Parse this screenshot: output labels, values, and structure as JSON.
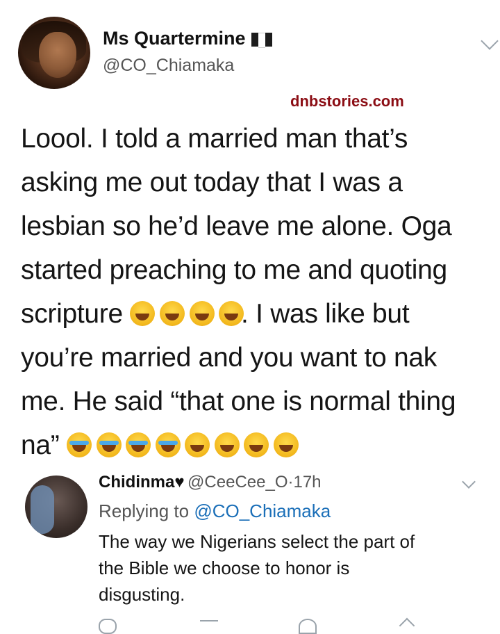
{
  "watermark": "dnbstories.com",
  "tweet": {
    "author_name": "Ms Quartermine",
    "author_handle": "@CO_Chiamaka",
    "lines": [
      "Loool. I told a married man that’s",
      "asking me out today that I was a",
      "lesbian so he’d leave me alone. Oga",
      "started preaching to me and quoting",
      "scripture",
      ". I was like but",
      "you’re married and you want to nak",
      "me. He said “that one is normal thing",
      "na”"
    ]
  },
  "reply": {
    "author_name": "Chidinma",
    "heart": "♥",
    "author_handle": "@CeeCee_O",
    "separator": "·",
    "time": "17h",
    "replying_prefix": "Replying to",
    "replying_to": "@CO_Chiamaka",
    "lines": [
      "The way we Nigerians select the part of",
      "the Bible we choose to honor is",
      "disgusting."
    ]
  },
  "colors": {
    "watermark": "#8b0d14",
    "mention": "#1b6fb8",
    "flag_green": "#118448"
  },
  "icons": {
    "laugh": "face-with-tears-of-joy-icon",
    "cry": "loudly-crying-face-icon"
  }
}
